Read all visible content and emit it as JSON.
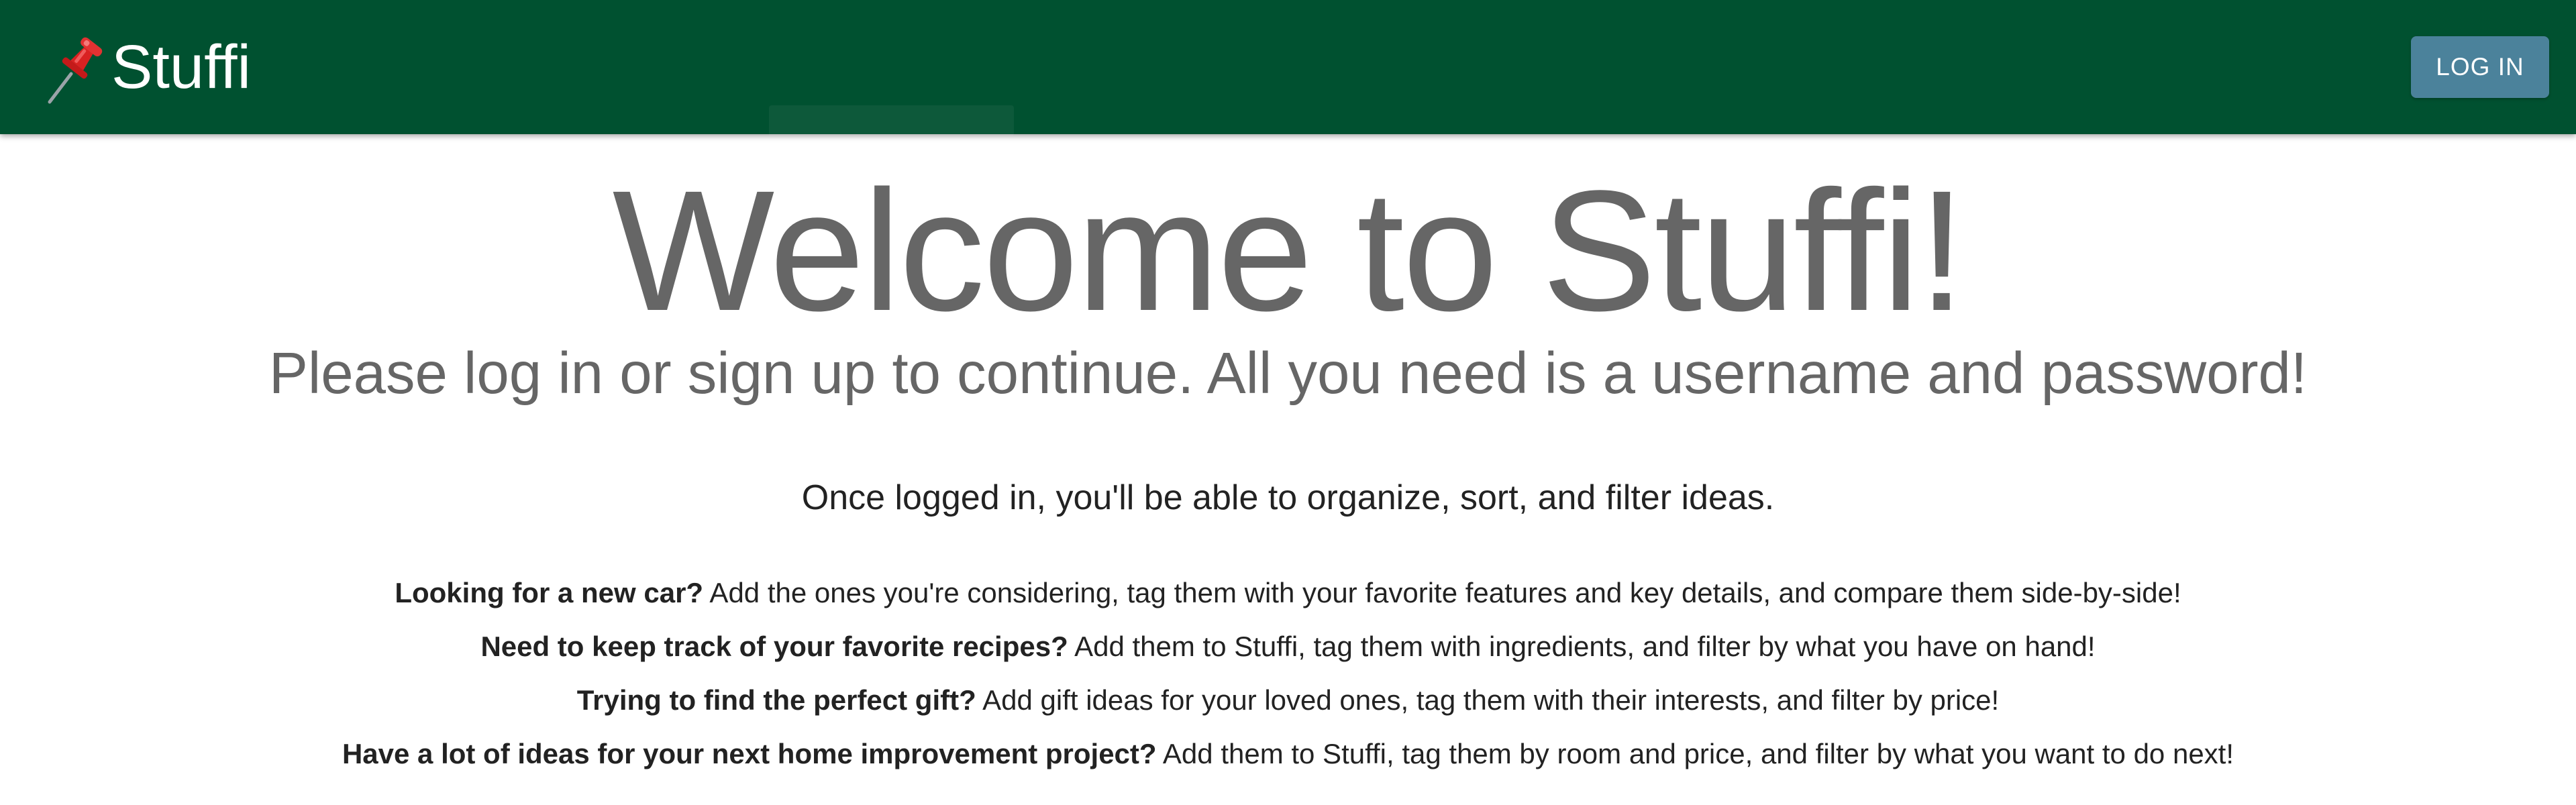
{
  "header": {
    "brand": "Stuffi",
    "login_label": "LOG IN",
    "accent_color": "#005130",
    "button_color": "#4b829b",
    "logo_icon": "pushpin-icon"
  },
  "main": {
    "title": "Welcome to Stuffi!",
    "subtitle": "Please log in or sign up to continue. All you need is a username and password!",
    "lead": "Once logged in, you'll be able to organize, sort, and filter ideas.",
    "features": [
      {
        "heading": "Looking for a new car?",
        "text": " Add the ones you're considering, tag them with your favorite features and key details, and compare them side-by-side!"
      },
      {
        "heading": "Need to keep track of your favorite recipes?",
        "text": " Add them to Stuffi, tag them with ingredients, and filter by what you have on hand!"
      },
      {
        "heading": "Trying to find the perfect gift?",
        "text": " Add gift ideas for your loved ones, tag them with their interests, and filter by price!"
      },
      {
        "heading": "Have a lot of ideas for your next home improvement project?",
        "text": " Add them to Stuffi, tag them by room and price, and filter by what you want to do next!"
      }
    ]
  }
}
